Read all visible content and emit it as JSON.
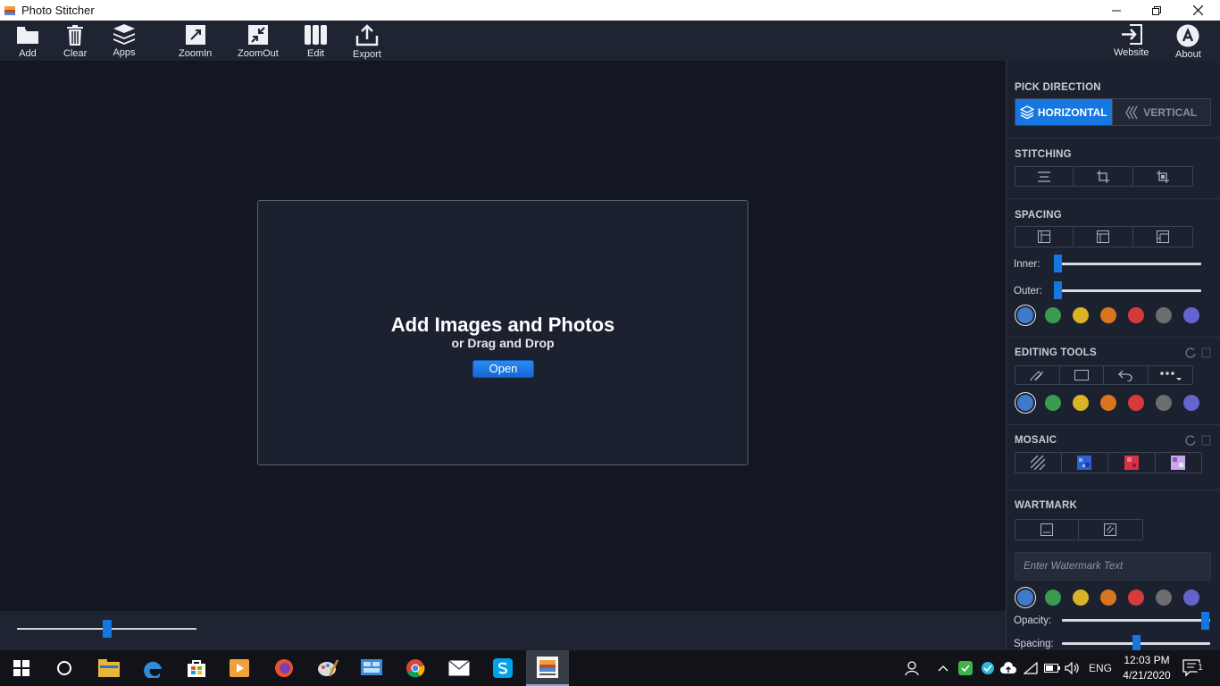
{
  "window": {
    "title": "Photo Stitcher"
  },
  "toolbar": {
    "add": "Add",
    "clear": "Clear",
    "apps": "Apps",
    "zoomin": "ZoomIn",
    "zoomout": "ZoomOut",
    "edit": "Edit",
    "export": "Export",
    "website": "Website",
    "about": "About"
  },
  "canvas": {
    "title": "Add Images and Photos",
    "subtitle": "or Drag and Drop",
    "open_label": "Open"
  },
  "panel": {
    "pick_direction": "PICK DIRECTION",
    "horizontal": "HORIZONTAL",
    "vertical": "VERTICAL",
    "stitching": "STITCHING",
    "spacing": "SPACING",
    "inner": "Inner:",
    "outer": "Outer:",
    "editing_tools": "EDITING TOOLS",
    "mosaic": "MOSAIC",
    "watermark": "WARTMARK",
    "watermark_placeholder": "Enter Watermark Text",
    "opacity": "Opacity:",
    "spacing_label": "Spacing:",
    "opacity_level": 1.0,
    "spacing_level": 0.5,
    "inner_level": 0.0,
    "outer_level": 0.0
  },
  "colors": {
    "accent": "#1677e0",
    "swatches": [
      "#3f79c9",
      "#3a9a4f",
      "#d8b426",
      "#d8751e",
      "#d63a3a",
      "#6d6d6d",
      "#6464cf"
    ]
  },
  "bottom": {
    "zoom_level": 0.5
  },
  "taskbar": {
    "language": "ENG",
    "time": "12:03 PM",
    "date": "4/21/2020",
    "notifications": "1"
  }
}
